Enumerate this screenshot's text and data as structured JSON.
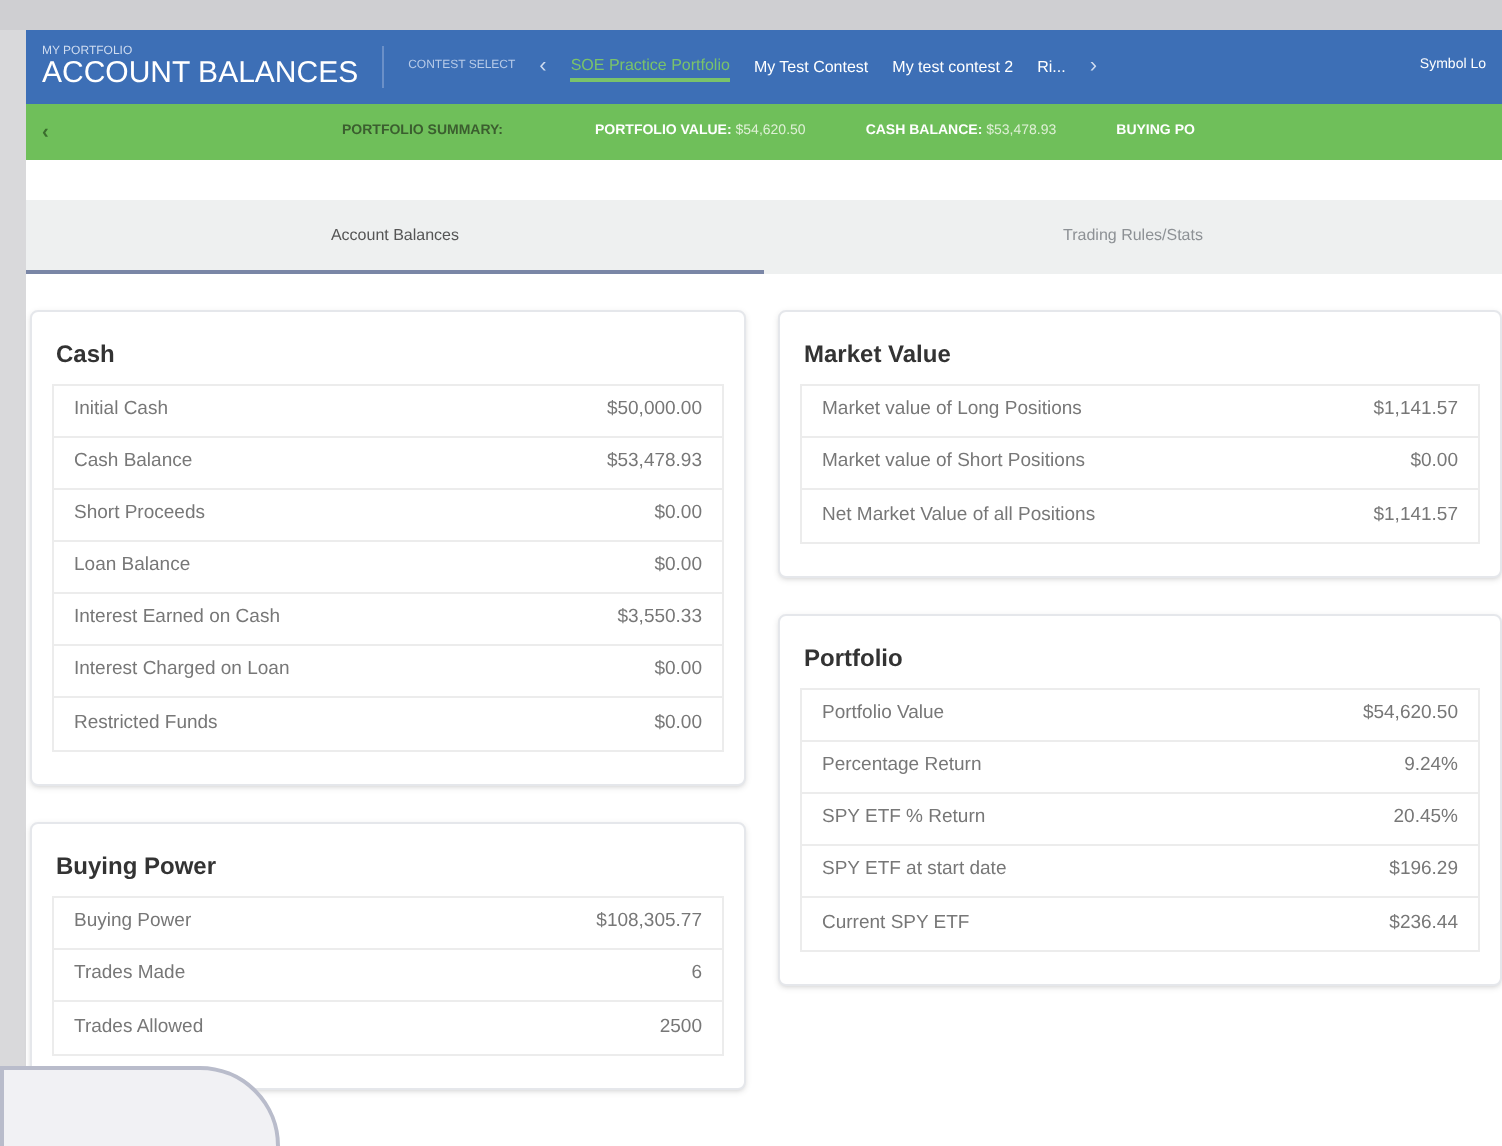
{
  "header": {
    "subtitle": "MY PORTFOLIO",
    "title": "ACCOUNT BALANCES",
    "contest_label": "CONTEST SELECT",
    "prev": "‹",
    "next": "›",
    "contests": [
      {
        "label": "SOE Practice Portfolio",
        "selected": true
      },
      {
        "label": "My Test Contest",
        "selected": false
      },
      {
        "label": "My test contest 2",
        "selected": false
      },
      {
        "label": "Ri...",
        "selected": false
      }
    ],
    "user": "Symbol Lo"
  },
  "summary_bar": {
    "back": "‹",
    "label": "PORTFOLIO SUMMARY:",
    "items": [
      {
        "label": "PORTFOLIO VALUE:",
        "value": "$54,620.50"
      },
      {
        "label": "CASH BALANCE:",
        "value": "$53,478.93"
      },
      {
        "label": "BUYING PO"
      }
    ]
  },
  "tabs": [
    {
      "label": "Account Balances",
      "selected": true
    },
    {
      "label": "Trading Rules/Stats",
      "selected": false
    }
  ],
  "left_cards": [
    {
      "title": "Cash",
      "rows": [
        {
          "label": "Initial Cash",
          "value": "$50,000.00"
        },
        {
          "label": "Cash Balance",
          "value": "$53,478.93"
        },
        {
          "label": "Short Proceeds",
          "value": "$0.00"
        },
        {
          "label": "Loan Balance",
          "value": "$0.00"
        },
        {
          "label": "Interest Earned on Cash",
          "value": "$3,550.33"
        },
        {
          "label": "Interest Charged on Loan",
          "value": "$0.00"
        },
        {
          "label": "Restricted Funds",
          "value": "$0.00"
        }
      ]
    },
    {
      "title": "Buying Power",
      "rows": [
        {
          "label": "Buying Power",
          "value": "$108,305.77"
        },
        {
          "label": "Trades Made",
          "value": "6"
        },
        {
          "label": "Trades Allowed",
          "value": "2500"
        }
      ]
    }
  ],
  "right_cards": [
    {
      "title": "Market Value",
      "rows": [
        {
          "label": "Market value of Long Positions",
          "value": "$1,141.57"
        },
        {
          "label": "Market value of Short Positions",
          "value": "$0.00"
        },
        {
          "label": "Net Market Value of all Positions",
          "value": "$1,141.57"
        }
      ]
    },
    {
      "title": "Portfolio",
      "rows": [
        {
          "label": "Portfolio Value",
          "value": "$54,620.50"
        },
        {
          "label": "Percentage Return",
          "value": "9.24%"
        },
        {
          "label": "SPY ETF % Return",
          "value": "20.45%"
        },
        {
          "label": "SPY ETF at start date",
          "value": "$196.29"
        },
        {
          "label": "Current SPY ETF",
          "value": "$236.44"
        }
      ]
    }
  ]
}
